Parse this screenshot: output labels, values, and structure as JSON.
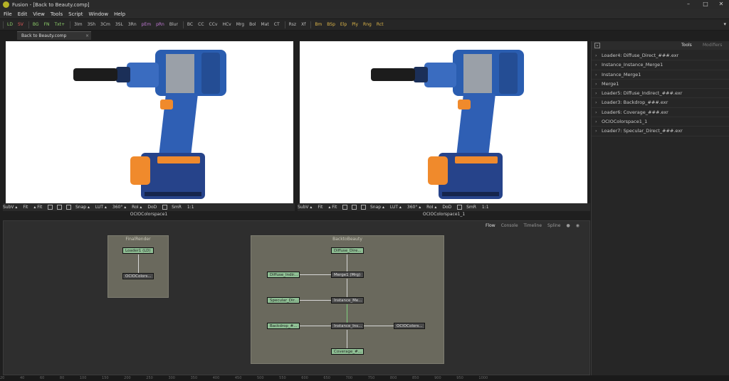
{
  "window": {
    "title": "Fusion - [Back to Beauty.comp]",
    "controls": [
      "–",
      "□",
      "✕"
    ]
  },
  "menu": [
    "File",
    "Edit",
    "View",
    "Tools",
    "Script",
    "Window",
    "Help"
  ],
  "toolbar": {
    "group1": [
      "LD",
      "SV"
    ],
    "group2": [
      "BG",
      "FN",
      "Txt+"
    ],
    "group3": [
      "3Im",
      "3Sh",
      "3Cm",
      "3SL",
      "3Rn"
    ],
    "group4": [
      "pEm",
      "pRn",
      "Blur"
    ],
    "group5": [
      "BC",
      "CC",
      "CCv",
      "HCv",
      "Mrg",
      "Bol",
      "Mat",
      "CT"
    ],
    "group6": [
      "Rsz",
      "Xf"
    ],
    "group7": [
      "Bm",
      "BSp",
      "Elp",
      "Ply",
      "Rng",
      "Rct"
    ]
  },
  "comp_tab": {
    "label": "Back to Beauty.comp",
    "close": "×"
  },
  "viewer_bar": {
    "left": [
      "SubV ▴",
      "Fit",
      "▴ Fit",
      "Snap ▴",
      "LUT ▴",
      "360° ▴",
      "RoI ▴",
      "DoD",
      "SmR",
      "1:1"
    ],
    "right": [
      "SubV ▴",
      "Fit",
      "▴ Fit",
      "Snap ▴",
      "LUT ▴",
      "360° ▴",
      "RoI ▴",
      "DoD",
      "SmR",
      "1:1"
    ]
  },
  "viewer_labels": {
    "left": "OCIOColorspace1",
    "right": "OCIOColorspace1_1"
  },
  "flow_tabs": [
    "Flow",
    "Console",
    "Timeline",
    "Spline"
  ],
  "groups": {
    "final": {
      "title": "FinalRender",
      "nodes": {
        "loader": "Loader1  (LD)",
        "ocio": "OCIOColors..."
      }
    },
    "beauty": {
      "title": "BacktoBeauty",
      "nodes": {
        "diffuse_direct": "Diffuse_Dire...",
        "diffuse_indir": "Diffuse_Indir...",
        "merge": "Merge1  (Mrg)",
        "specular": "Specular_Dir...",
        "instance_merge": "Instance_Me...",
        "backdrop": "Backdrop_#...",
        "instance_ins": "Instance_Ins...",
        "ocio": "OCIOColors...",
        "coverage": "Coverage_#..."
      }
    }
  },
  "right_panel": {
    "tabs": [
      "Tools",
      "Modifiers"
    ],
    "items": [
      "Loader4: Diffuse_Direct_###.exr",
      "Instance_Instance_Merge1",
      "Instance_Merge1",
      "Merge1",
      "Loader5: Diffuse_Indirect_###.exr",
      "Loader3: Backdrop_###.exr",
      "Loader6: Coverage_###.exr",
      "OCIOColorspace1_1",
      "Loader7: Specular_Direct_###.exr"
    ]
  },
  "timeline_ticks": [
    "20",
    "40",
    "60",
    "80",
    "100",
    "150",
    "200",
    "250",
    "300",
    "350",
    "400",
    "450",
    "500",
    "550",
    "600",
    "650",
    "700",
    "750",
    "800",
    "850",
    "900",
    "950",
    "1000"
  ],
  "colors": {
    "viewer_bg": "#ffffff",
    "drill_blue": "#2a5db0",
    "drill_orange": "#f08a2c",
    "group_bg": "#6a695d",
    "loader_green": "#8fbf94"
  }
}
